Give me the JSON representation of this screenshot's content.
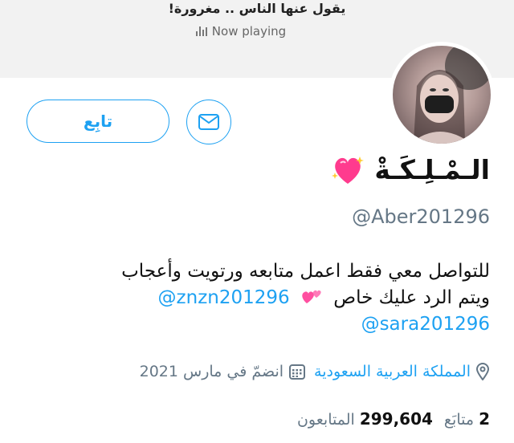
{
  "now_playing": {
    "song_title": "يقول عنها الناس .. مغرورة!",
    "label": "Now playing"
  },
  "profile": {
    "display_name": "الـمْـلِـكَـةْ",
    "handle": "@Aber201296",
    "bio_line1": "للتواصل معي فقط اعمل متابعه ورتويت وأعجاب",
    "bio_line2_text": "ويتم الرد عليك خاص",
    "bio_mention1": "@znzn201296",
    "bio_mention2": "@sara201296",
    "location": "المملكة العربية السعودية",
    "joined": "انضمّ في مارس 2021"
  },
  "actions": {
    "follow_label": "تابِع"
  },
  "stats": {
    "following_count": "2",
    "following_label": "متابَع",
    "followers_count": "299,604",
    "followers_label": "المتابعون"
  },
  "colors": {
    "accent": "#1da1f2",
    "secondary_text": "#657786",
    "header_bg": "#f2f2f2"
  },
  "icons": {
    "message": "envelope-icon",
    "location": "location-pin-icon",
    "calendar": "calendar-icon",
    "now_playing": "audio-bars-icon",
    "name_emoji": "sparkling-heart-icon",
    "bio_emoji": "two-hearts-icon"
  }
}
